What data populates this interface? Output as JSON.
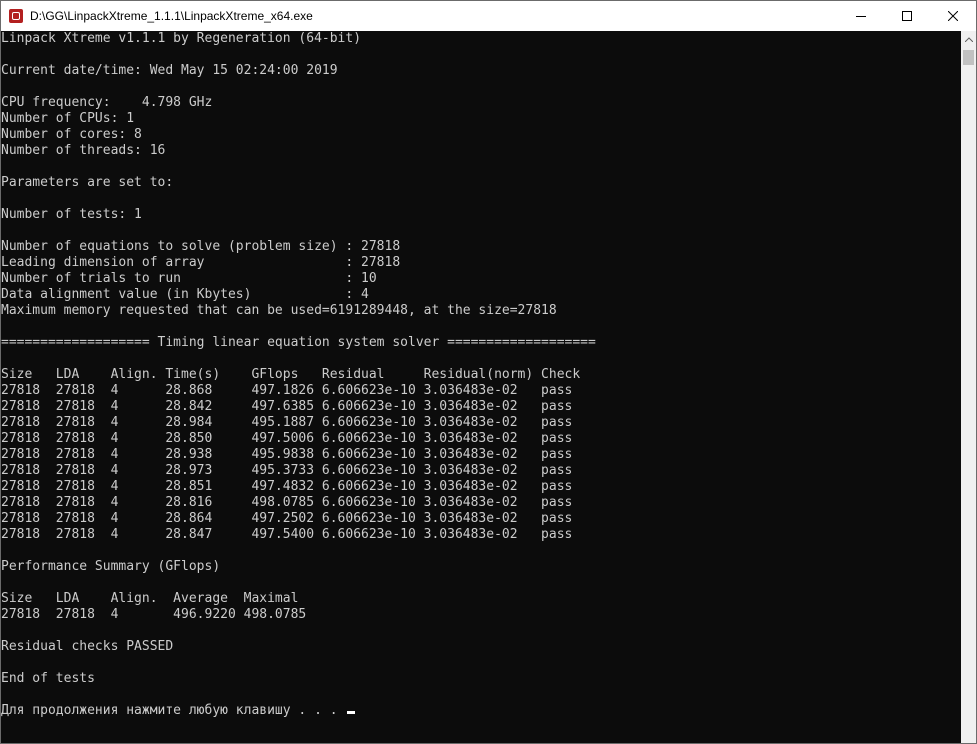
{
  "window": {
    "title": "D:\\GG\\LinpackXtreme_1.1.1\\LinpackXtreme_x64.exe",
    "icon": "linpack-app-icon"
  },
  "controls": {
    "minimize_icon": "minimize-icon",
    "maximize_icon": "maximize-icon",
    "close_icon": "close-icon"
  },
  "console": {
    "lines": [
      "Linpack Xtreme v1.1.1 by Regeneration (64-bit)",
      "",
      "Current date/time: Wed May 15 02:24:00 2019",
      "",
      "CPU frequency:    4.798 GHz",
      "Number of CPUs: 1",
      "Number of cores: 8",
      "Number of threads: 16",
      "",
      "Parameters are set to:",
      "",
      "Number of tests: 1",
      "",
      "Number of equations to solve (problem size) : 27818",
      "Leading dimension of array                  : 27818",
      "Number of trials to run                     : 10",
      "Data alignment value (in Kbytes)            : 4",
      "Maximum memory requested that can be used=6191289448, at the size=27818",
      "",
      "=================== Timing linear equation system solver ===================",
      "",
      "Size   LDA    Align. Time(s)    GFlops   Residual     Residual(norm) Check",
      "27818  27818  4      28.868     497.1826 6.606623e-10 3.036483e-02   pass",
      "27818  27818  4      28.842     497.6385 6.606623e-10 3.036483e-02   pass",
      "27818  27818  4      28.984     495.1887 6.606623e-10 3.036483e-02   pass",
      "27818  27818  4      28.850     497.5006 6.606623e-10 3.036483e-02   pass",
      "27818  27818  4      28.938     495.9838 6.606623e-10 3.036483e-02   pass",
      "27818  27818  4      28.973     495.3733 6.606623e-10 3.036483e-02   pass",
      "27818  27818  4      28.851     497.4832 6.606623e-10 3.036483e-02   pass",
      "27818  27818  4      28.816     498.0785 6.606623e-10 3.036483e-02   pass",
      "27818  27818  4      28.864     497.2502 6.606623e-10 3.036483e-02   pass",
      "27818  27818  4      28.847     497.5400 6.606623e-10 3.036483e-02   pass",
      "",
      "Performance Summary (GFlops)",
      "",
      "Size   LDA    Align.  Average  Maximal",
      "27818  27818  4       496.9220 498.0785",
      "",
      "Residual checks PASSED",
      "",
      "End of tests",
      ""
    ],
    "prompt": "Для продолжения нажмите любую клавишу . . . "
  },
  "colors": {
    "console_bg": "#0c0c0c",
    "console_fg": "#cccccc",
    "titlebar_bg": "#ffffff"
  }
}
